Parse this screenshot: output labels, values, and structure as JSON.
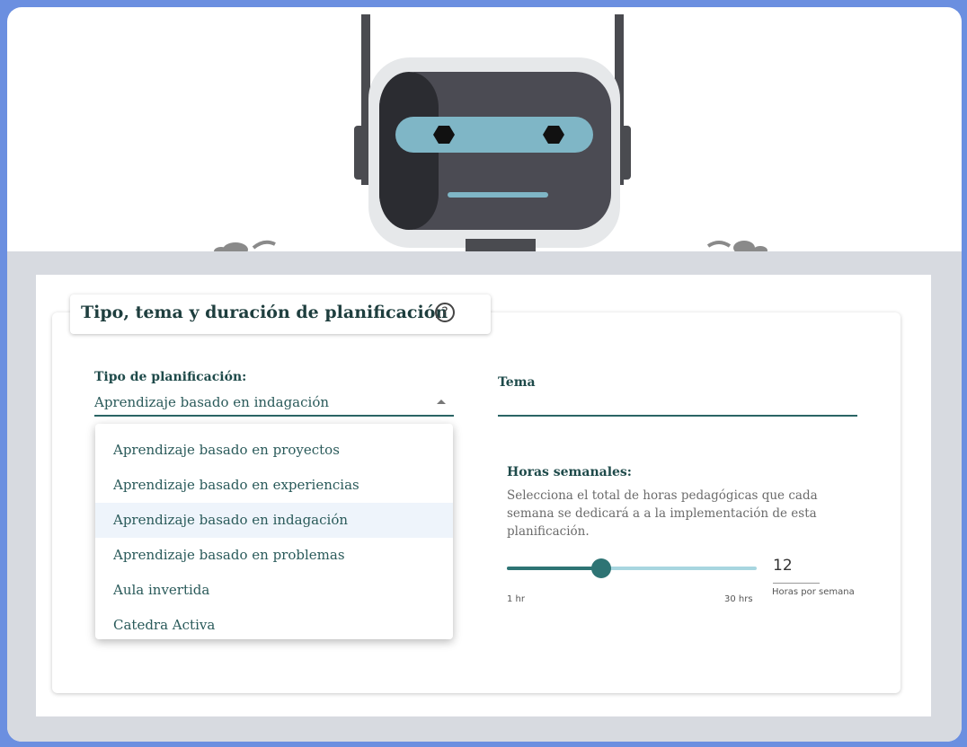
{
  "card": {
    "title": "Tipo, tema y duración de planificación",
    "help_icon": "help-circle-icon"
  },
  "tipo": {
    "label": "Tipo de planificación:",
    "selected": "Aprendizaje basado en indagación",
    "options": [
      "Aprendizaje basado en proyectos",
      "Aprendizaje basado en experiencias",
      "Aprendizaje basado en indagación",
      "Aprendizaje basado en problemas",
      "Aula invertida",
      "Catedra Activa"
    ],
    "highlighted_index": 2
  },
  "tema": {
    "label": "Tema",
    "value": ""
  },
  "horas": {
    "title": "Horas semanales:",
    "description": "Selecciona el total de horas pedagógicas que cada semana se dedicará a a la implementación de esta planificación.",
    "min": 1,
    "max": 30,
    "value": 12,
    "min_label": "1 hr",
    "max_label": "30 hrs",
    "value_text": "12",
    "caption": "Horas por semana"
  },
  "colors": {
    "page_bg": "#6b8fe0",
    "accent": "#2e7474",
    "track": "#a8d6e0",
    "highlight": "#eef4fb"
  }
}
